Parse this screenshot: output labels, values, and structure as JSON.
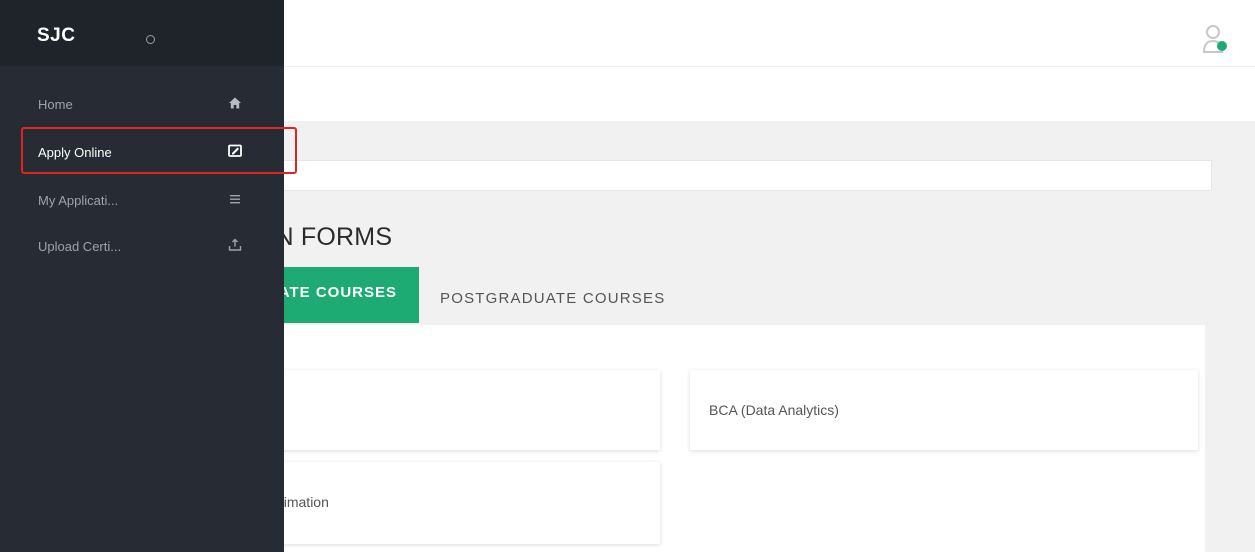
{
  "brand": {
    "name": "SJC"
  },
  "sidebar": {
    "items": [
      {
        "label": "Home",
        "icon": "home-icon",
        "active": false
      },
      {
        "label": "Apply Online",
        "icon": "edit-form-icon",
        "active": true
      },
      {
        "label": "My Applicati...",
        "icon": "list-icon",
        "active": false
      },
      {
        "label": "Upload Certi...",
        "icon": "upload-icon",
        "active": false
      }
    ]
  },
  "header": {
    "user_status_color": "#1daa73"
  },
  "main": {
    "section_title": "CATION FORMS",
    "tabs": [
      {
        "label": "ATE COURSES",
        "active": true
      },
      {
        "label": "POSTGRADUATE COURSES",
        "active": false
      }
    ],
    "courses": [
      {
        "label": ""
      },
      {
        "label": "BCA (Data Analytics)"
      },
      {
        "label": "nedia and Animation"
      }
    ]
  },
  "colors": {
    "sidebar_bg": "#272c34",
    "accent": "#1daa73",
    "highlight": "#e02424"
  }
}
